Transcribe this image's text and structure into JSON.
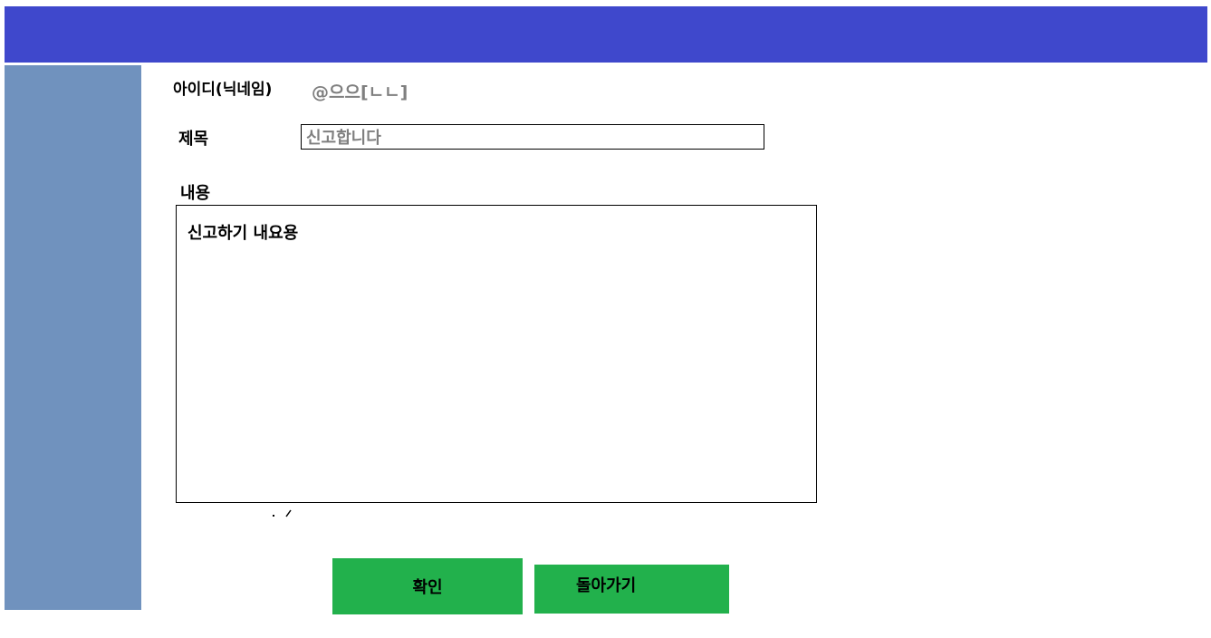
{
  "form": {
    "id_label": "아이디(닉네임)",
    "id_value": "@으으[ㄴㄴ]",
    "title_label": "제목",
    "title_value": "신고합니다",
    "content_label": "내용",
    "content_value": "신고하기 내요용"
  },
  "actions": {
    "confirm_label": "확인",
    "back_label": "돌아가기"
  },
  "colors": {
    "banner": "#3f48cc",
    "sidebar": "#7092be",
    "button": "#22b14c",
    "muted_text": "#7f7f7f"
  }
}
